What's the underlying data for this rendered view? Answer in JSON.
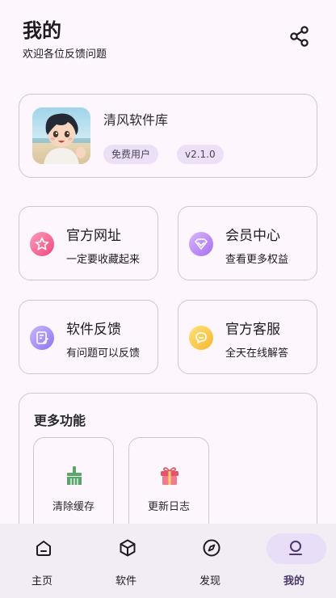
{
  "header": {
    "title": "我的",
    "subtitle": "欢迎各位反馈问题",
    "share_icon": "share-icon"
  },
  "profile": {
    "app_name": "清风软件库",
    "user_type": "免费用户",
    "version": "v2.1.0"
  },
  "tiles": [
    {
      "title": "官方网址",
      "subtitle": "一定要收藏起来",
      "icon": "star-badge-icon"
    },
    {
      "title": "会员中心",
      "subtitle": "查看更多权益",
      "icon": "vip-diamond-icon"
    },
    {
      "title": "软件反馈",
      "subtitle": "有问题可以反馈",
      "icon": "feedback-edit-icon"
    },
    {
      "title": "官方客服",
      "subtitle": "全天在线解答",
      "icon": "chat-bubble-icon"
    }
  ],
  "more": {
    "title": "更多功能",
    "items": [
      {
        "label": "清除缓存",
        "icon": "broom-icon"
      },
      {
        "label": "更新日志",
        "icon": "gift-icon"
      }
    ]
  },
  "nav": {
    "items": [
      {
        "label": "主页",
        "icon": "home-icon"
      },
      {
        "label": "软件",
        "icon": "box-icon"
      },
      {
        "label": "发现",
        "icon": "compass-icon"
      },
      {
        "label": "我的",
        "icon": "person-icon",
        "active": true
      }
    ]
  },
  "colors": {
    "background": "#fdf7fd",
    "border": "#cfc6d3",
    "chip": "#ebe0f5",
    "nav_background": "#f2ecf4",
    "nav_active": "#e8def8"
  }
}
